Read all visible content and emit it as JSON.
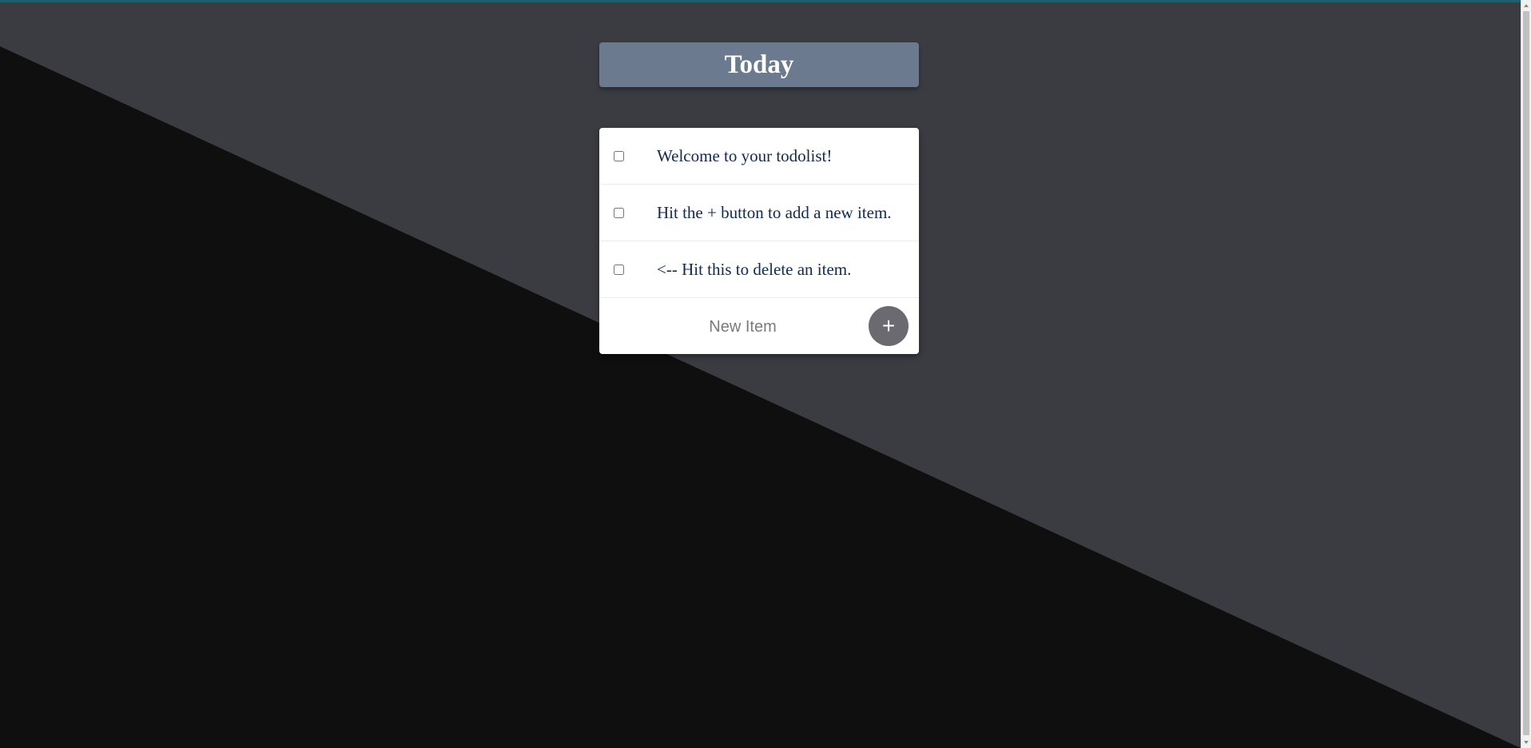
{
  "colors": {
    "background_upper": "#3b3c42",
    "background_lower": "#0f0f10",
    "title_bar": "#6b7a8f",
    "item_text": "#102a54",
    "add_button": "#6b6a70"
  },
  "header": {
    "title": "Today"
  },
  "items": [
    {
      "label": "Welcome to your todolist!",
      "checked": false
    },
    {
      "label": "Hit the + button to add a new item.",
      "checked": false
    },
    {
      "label": "<-- Hit this to delete an item.",
      "checked": false
    }
  ],
  "new_item": {
    "placeholder": "New Item",
    "value": "",
    "add_label": "+"
  }
}
